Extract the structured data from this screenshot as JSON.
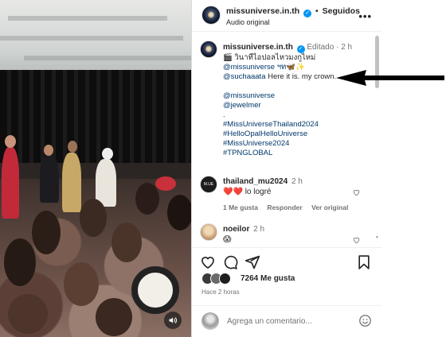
{
  "post": {
    "username": "missuniverse.in.th",
    "follow_state": "Seguidos",
    "audio": "Audio original",
    "more": "•••"
  },
  "caption": {
    "username": "missuniverse.in.th",
    "edited": "Editado",
    "time": "2 h",
    "lines": [
      "🎬 วินาทีไอปอลไหวมงกูไหม่",
      "@missuniverse ฯท🦋✨",
      "@suchaaata Here it is. my crown.",
      "",
      "@missuniverse",
      "@jewelmer",
      ".",
      "#MissUniverseThailand2024",
      "#HelloOpalHelloUniverse",
      "#MissUniverse2024",
      "#TPNGLOBAL"
    ]
  },
  "comments": [
    {
      "username": "thailand_mu2024",
      "time": "2 h",
      "hearts": "❤️❤️",
      "text": "lo logré",
      "likes": "1 Me gusta",
      "reply": "Responder",
      "translate": "Ver original",
      "avatar_label": "M.UE"
    },
    {
      "username": "noeilor",
      "time": "2 h",
      "text": "😱"
    }
  ],
  "likes": {
    "count_text": "7264 Me gusta"
  },
  "time_ago": "Hace 2 horas",
  "add_comment": {
    "placeholder": "Agrega un comentario..."
  },
  "colors": {
    "verified": "#0095f6",
    "link": "#00376b",
    "heart": "#ed4956",
    "meta": "#737373"
  },
  "icons": [
    "verified-icon",
    "more-icon",
    "heart-icon",
    "comment-icon",
    "share-icon",
    "bookmark-icon",
    "emoji-icon",
    "sound-icon",
    "arrow-annotation"
  ]
}
